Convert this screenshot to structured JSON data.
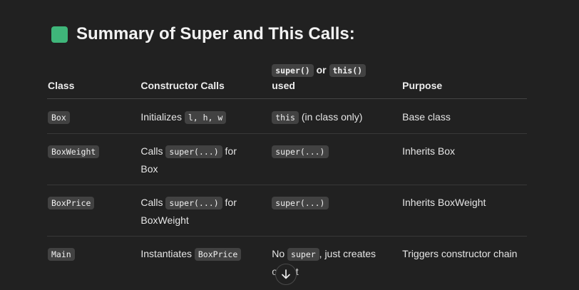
{
  "heading": {
    "icon": "green-square-icon",
    "icon_color": "#3fb67a",
    "title": "Summary of Super and This Calls:"
  },
  "table": {
    "headers": {
      "class": "Class",
      "constructor_calls": "Constructor Calls",
      "used_code_1": "super()",
      "used_or": "or",
      "used_code_2": "this()",
      "used_text": "used",
      "purpose": "Purpose"
    },
    "rows": [
      {
        "class_code": "Box",
        "calls_text": "Initializes",
        "calls_code": "l, h, w",
        "used_code": "this",
        "used_text": "(in class only)",
        "purpose": "Base class"
      },
      {
        "class_code": "BoxWeight",
        "calls_text": "Calls",
        "calls_code": "super(...)",
        "calls_after": "for",
        "calls_line2": "Box",
        "used_code": "super(...)",
        "purpose": "Inherits Box"
      },
      {
        "class_code": "BoxPrice",
        "calls_text": "Calls",
        "calls_code": "super(...)",
        "calls_after": "for",
        "calls_line2": "BoxWeight",
        "used_code": "super(...)",
        "purpose": "Inherits BoxWeight"
      },
      {
        "class_code": "Main",
        "calls_text": "Instantiates",
        "calls_code": "BoxPrice",
        "used_pre": "No",
        "used_code": "super",
        "used_text": ", just creates",
        "used_line2": "object",
        "purpose": "Triggers constructor chain"
      }
    ]
  },
  "scroll_button": {
    "icon": "arrow-down-icon"
  }
}
